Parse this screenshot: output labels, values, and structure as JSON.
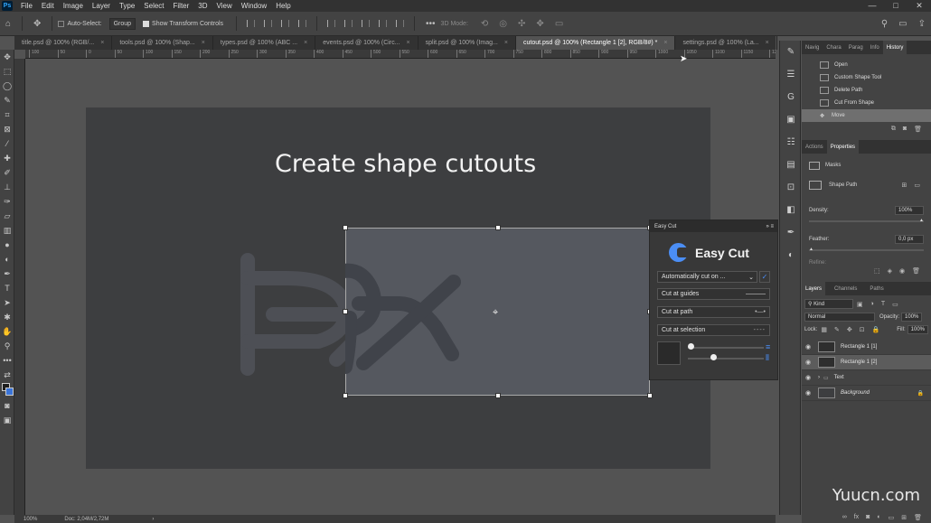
{
  "menubar": {
    "logo": "Ps",
    "items": [
      "File",
      "Edit",
      "Image",
      "Layer",
      "Type",
      "Select",
      "Filter",
      "3D",
      "View",
      "Window",
      "Help"
    ],
    "window_controls": [
      "—",
      "□",
      "✕"
    ]
  },
  "optbar": {
    "auto_select_label": "Auto-Select:",
    "auto_select_value": "Group",
    "show_transform_label": "Show Transform Controls",
    "mode_label": "3D Mode:"
  },
  "tabs": [
    {
      "label": "title.psd @ 100% (RGB/..."
    },
    {
      "label": "tools.psd @ 100% (Shap..."
    },
    {
      "label": "types.psd @ 100% (ABC ..."
    },
    {
      "label": "events.psd @ 100% (Circ..."
    },
    {
      "label": "split.psd @ 100% (Imag..."
    },
    {
      "label": "cutout.psd @ 100% (Rectangle 1 [2], RGB/8#) *"
    },
    {
      "label": "settings.psd @ 100% (La..."
    }
  ],
  "ruler_ticks": [
    "100",
    "50",
    "0",
    "50",
    "100",
    "150",
    "200",
    "250",
    "300",
    "350",
    "400",
    "450",
    "500",
    "550",
    "600",
    "650",
    "700",
    "750",
    "800",
    "850",
    "900",
    "950",
    "1000",
    "1050",
    "1100",
    "1150",
    "120"
  ],
  "canvas": {
    "headline": "Create shape cutouts"
  },
  "statusbar": {
    "zoom": "100%",
    "doc": "Doc: 2,04M/2,72M"
  },
  "easycut": {
    "panel_title": "Easy Cut",
    "logo_text": "Easy Cut",
    "auto_cut_label": "Automatically cut on ...",
    "cut_guides": "Cut at guides",
    "cut_path": "Cut at path",
    "cut_selection": "Cut at selection"
  },
  "history": {
    "tabs": [
      "Navig",
      "Chara",
      "Parag",
      "Info",
      "History"
    ],
    "items": [
      "Open",
      "Custom Shape Tool",
      "Delete Path",
      "Cut From Shape",
      "Move"
    ]
  },
  "properties": {
    "tabs": [
      "Actions",
      "Properties"
    ],
    "masks_label": "Masks",
    "shape_path_label": "Shape Path",
    "density_label": "Density:",
    "density_value": "100%",
    "feather_label": "Feather:",
    "feather_value": "0,0 px",
    "refine_label": "Refine:"
  },
  "layers": {
    "tabs": [
      "Layers",
      "Channels",
      "Paths"
    ],
    "kind_label": "Kind",
    "blend_mode": "Normal",
    "opacity_label": "Opacity:",
    "opacity_value": "100%",
    "lock_label": "Lock:",
    "fill_label": "Fill:",
    "fill_value": "100%",
    "items": [
      {
        "name": "Rectangle 1 [1]"
      },
      {
        "name": "Rectangle 1 [2]"
      },
      {
        "name": "Text"
      },
      {
        "name": "Background"
      }
    ]
  },
  "watermark": "Yuucn.com",
  "colors": {
    "accent": "#4b8ef5",
    "canvas_bg": "#535353",
    "artboard": "#3d3e40"
  }
}
